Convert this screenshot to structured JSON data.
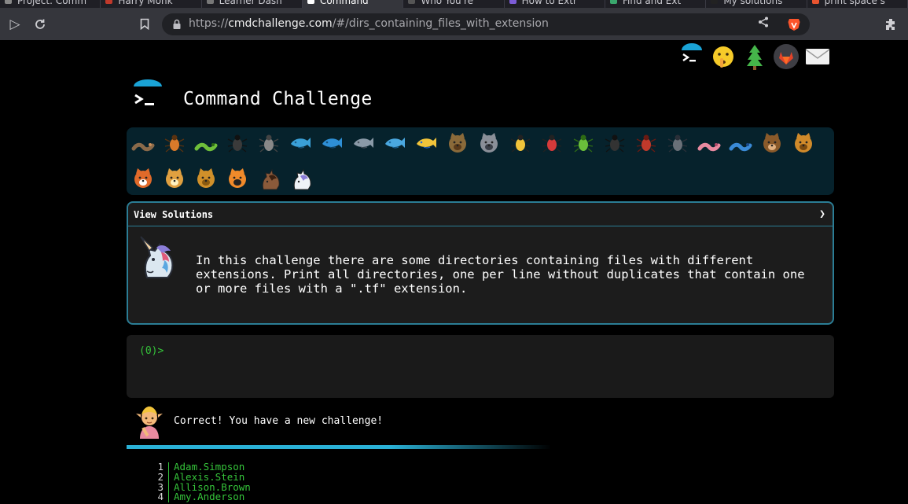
{
  "browser": {
    "tabs": [
      {
        "label": "Project: Comm",
        "active": false,
        "favicon_color": "#888888"
      },
      {
        "label": "Harry Monk",
        "active": false,
        "favicon_color": "#c0392b"
      },
      {
        "label": "Learner Dash",
        "active": false,
        "favicon_color": "#777777"
      },
      {
        "label": "Command",
        "active": true,
        "favicon_color": "#ffffff"
      },
      {
        "label": "Who You're",
        "active": false,
        "favicon_color": "#555555"
      },
      {
        "label": "How to Extr",
        "active": false,
        "favicon_color": "#7c5cd6"
      },
      {
        "label": "Find and Ext",
        "active": false,
        "favicon_color": "#3aa76d"
      },
      {
        "label": "My solutions",
        "active": false,
        "favicon_color": "#222222"
      },
      {
        "label": "print space s",
        "active": false,
        "favicon_color": "#e8542f"
      }
    ],
    "url_scheme": "https://",
    "url_host": "cmdchallenge.com",
    "url_path": "/#/dirs_containing_files_with_extension",
    "accent": "#fb542b"
  },
  "header": {
    "title": "Command Challenge",
    "nav_icons": [
      "terminal-icon",
      "shush-face-icon",
      "tree-icon",
      "gitlab-icon",
      "mail-icon"
    ]
  },
  "challenges": {
    "icons": [
      "snail",
      "butterfly",
      "caterpillar",
      "ant",
      "spider-web",
      "whale",
      "dolphin-blue",
      "dolphin-grey",
      "fish",
      "tropical-fish",
      "blowfish",
      "wolf",
      "bee",
      "ladybug",
      "cricket",
      "spider",
      "scorpion",
      "fly",
      "worm",
      "paramecium",
      "monkey",
      "dog",
      "fox",
      "cat",
      "lion",
      "tiger",
      "horse",
      "unicorn"
    ],
    "current": "unicorn"
  },
  "panel": {
    "title": "View Solutions",
    "chevron": "❯",
    "challenge_text": "In this challenge there are some directories containing files with different\nextensions. Print all directories, one per line without duplicates that contain one\nor more files with a \".tf\" extension."
  },
  "terminal": {
    "prompt": "(0)>",
    "input": ""
  },
  "status": {
    "message": "Correct! You have a new challenge!"
  },
  "output": {
    "lines": [
      {
        "n": "1",
        "text": "Adam.Simpson"
      },
      {
        "n": "2",
        "text": "Alexis.Stein"
      },
      {
        "n": "3",
        "text": "Allison.Brown"
      },
      {
        "n": "4",
        "text": "Amy.Anderson"
      }
    ]
  },
  "colors": {
    "panel_border": "#2b7d95",
    "prompt_green": "#35c43a",
    "progress": "#2ab1d6"
  }
}
